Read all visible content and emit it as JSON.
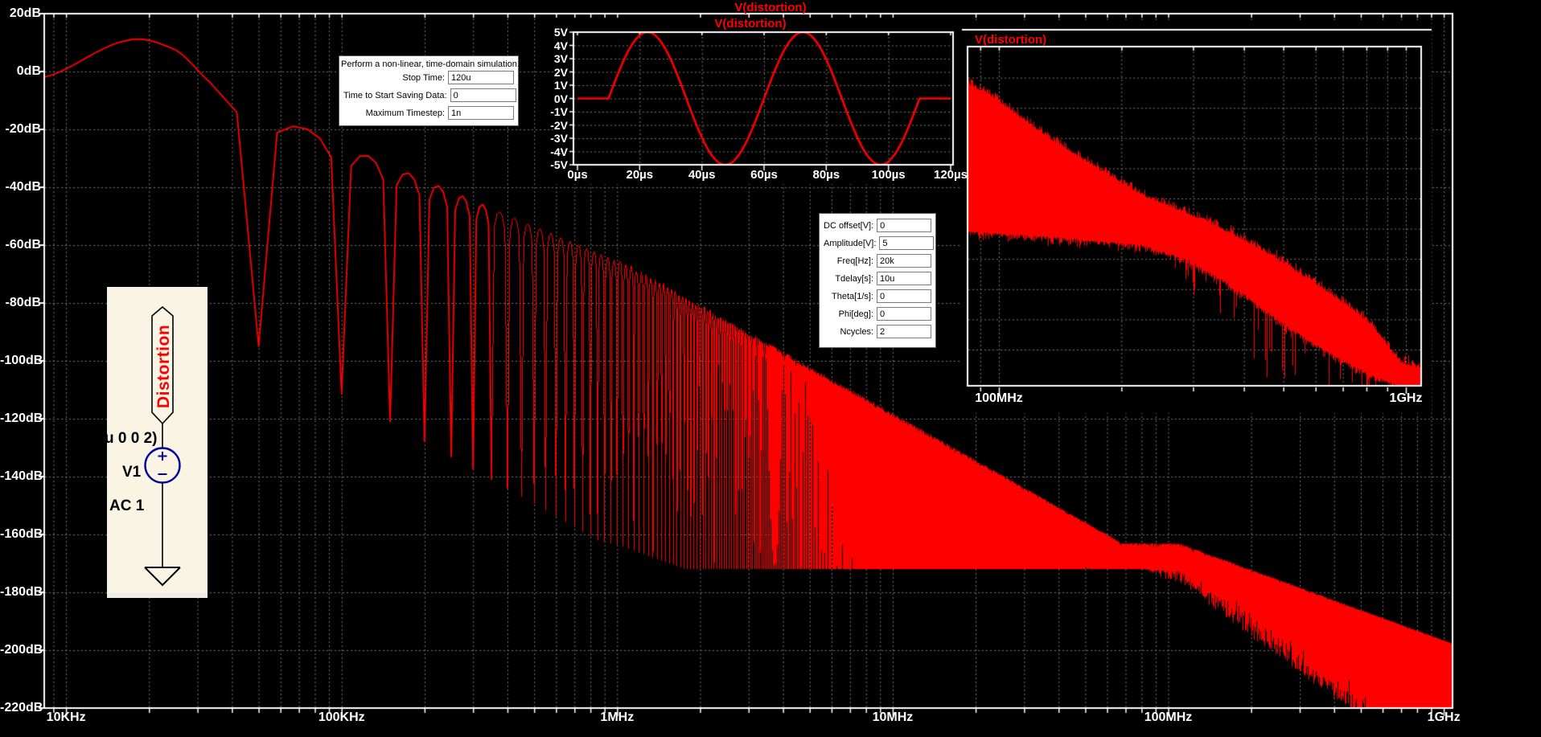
{
  "titles": {
    "main": "V(distortion)",
    "time_inset": "V(distortion)",
    "freq_inset": "V(distortion)"
  },
  "colors": {
    "trace": "#FF0000",
    "grid": "#787878",
    "axis": "#FFFFFF",
    "bg": "#000000",
    "schematic_bg": "#F9F4E4",
    "component": "#0000A0",
    "net_label_text": "#FF0000"
  },
  "transient_dialog": {
    "title": "Perform a non-linear, time-domain simulation.",
    "fields": [
      {
        "label": "Stop Time:",
        "value": "120u"
      },
      {
        "label": "Time to Start Saving Data:",
        "value": "0"
      },
      {
        "label": "Maximum Timestep:",
        "value": "1n"
      }
    ]
  },
  "sine_dialog": {
    "fields": [
      {
        "label": "DC offset[V]:",
        "value": "0"
      },
      {
        "label": "Amplitude[V]:",
        "value": "5"
      },
      {
        "label": "Freq[Hz]:",
        "value": "20k"
      },
      {
        "label": "Tdelay[s]:",
        "value": "10u"
      },
      {
        "label": "Theta[1/s]:",
        "value": "0"
      },
      {
        "label": "Phi[deg]:",
        "value": "0"
      },
      {
        "label": "Ncycles:",
        "value": "2"
      }
    ]
  },
  "schematic": {
    "net_label": "Distortion",
    "overlay_text": "u 0 0 2)",
    "designator": "V1",
    "spice_directive": "AC 1"
  },
  "chart_data": [
    {
      "type": "line",
      "id": "main_fft",
      "title": "V(distortion)",
      "xscale": "log",
      "xrange_hz": [
        8333.3,
        1092000000
      ],
      "yrange_db": [
        -220,
        20
      ],
      "grid": true,
      "legend_position": "top-center",
      "y_ticks": [
        {
          "db": 20,
          "label": "20dB"
        },
        {
          "db": 0,
          "label": "0dB"
        },
        {
          "db": -20,
          "label": "-20dB"
        },
        {
          "db": -40,
          "label": "-40dB"
        },
        {
          "db": -60,
          "label": "-60dB"
        },
        {
          "db": -80,
          "label": "-80dB"
        },
        {
          "db": -100,
          "label": "-100dB"
        },
        {
          "db": -120,
          "label": "-120dB"
        },
        {
          "db": -140,
          "label": "-140dB"
        },
        {
          "db": -160,
          "label": "-160dB"
        },
        {
          "db": -180,
          "label": "-180dB"
        },
        {
          "db": -200,
          "label": "-200dB"
        },
        {
          "db": -220,
          "label": "-220dB"
        }
      ],
      "x_ticks": [
        {
          "f": 10000,
          "label": "10KHz"
        },
        {
          "f": 100000,
          "label": "100KHz"
        },
        {
          "f": 1000000,
          "label": "1MHz"
        },
        {
          "f": 10000000,
          "label": "10MHz"
        },
        {
          "f": 100000000,
          "label": "100MHz"
        },
        {
          "f": 1000000000,
          "label": "1GHz"
        }
      ],
      "model": {
        "amplitude_v": 5,
        "f0_hz": 20000,
        "burst_s": 0.0001,
        "window_s": 0.00012,
        "bin_hz": 8333.333,
        "peak_db": 12,
        "left_edge_db": -6,
        "extra_rolloff_db_per_decade": 14,
        "rolloff_start_hz": 1000000,
        "noise_floor_db": -172,
        "floor_knee_hz": 110000000,
        "floor_slope_db_per_decade": 35,
        "notch_limit": {
          "db_at_ref": -95,
          "ref_hz": 50000,
          "slope_db_per_decade": 54.5,
          "min_db": -172
        }
      }
    },
    {
      "type": "line",
      "id": "time_domain",
      "title": "V(distortion)",
      "xrange_us": [
        0,
        120
      ],
      "yrange_v": [
        -5,
        5
      ],
      "grid": true,
      "params": {
        "amplitude_v": 5,
        "freq_hz": 20000,
        "tdelay_us": 10,
        "ncycles": 2,
        "tstop_us": 120
      },
      "y_ticks": [
        {
          "v": 5,
          "label": "5V"
        },
        {
          "v": 4,
          "label": "4V"
        },
        {
          "v": 3,
          "label": "3V"
        },
        {
          "v": 2,
          "label": "2V"
        },
        {
          "v": 1,
          "label": "1V"
        },
        {
          "v": 0,
          "label": "0V"
        },
        {
          "v": -1,
          "label": "-1V"
        },
        {
          "v": -2,
          "label": "-2V"
        },
        {
          "v": -3,
          "label": "-3V"
        },
        {
          "v": -4,
          "label": "-4V"
        },
        {
          "v": -5,
          "label": "-5V"
        }
      ],
      "x_ticks": [
        {
          "t": 0,
          "label": "0µs"
        },
        {
          "t": 20,
          "label": "20µs"
        },
        {
          "t": 40,
          "label": "40µs"
        },
        {
          "t": 60,
          "label": "60µs"
        },
        {
          "t": 80,
          "label": "80µs"
        },
        {
          "t": 100,
          "label": "100µs"
        },
        {
          "t": 120,
          "label": "120µs"
        }
      ]
    },
    {
      "type": "line",
      "id": "fft_zoom",
      "title": "V(distortion)",
      "xscale": "log",
      "xrange_hz": [
        83700000,
        1092000000
      ],
      "grid": true,
      "x_ticks": [
        {
          "f": 100000000,
          "label": "100MHz"
        },
        {
          "f": 1000000000,
          "label": "1GHz"
        }
      ],
      "top_envelope": [
        {
          "f_hz": 83740000,
          "frac": 0.0974
        },
        {
          "f_hz": 99100000,
          "frac": 0.1497
        },
        {
          "f_hz": 136300000,
          "frac": 0.2708
        },
        {
          "f_hz": 224800000,
          "frac": 0.4299
        },
        {
          "f_hz": 323500000,
          "frac": 0.5059
        },
        {
          "f_hz": 444800000,
          "frac": 0.5914
        },
        {
          "f_hz": 631600000,
          "frac": 0.7078
        },
        {
          "f_hz": 814900000,
          "frac": 0.8076
        },
        {
          "f_hz": 968700000,
          "frac": 0.924
        },
        {
          "f_hz": 1085000000,
          "frac": 0.9406
        }
      ],
      "bottom_envelope": [
        {
          "f_hz": 83740000,
          "frac": 0.5439
        },
        {
          "f_hz": 136300000,
          "frac": 0.5606
        },
        {
          "f_hz": 225700000,
          "frac": 0.5843
        },
        {
          "f_hz": 291000000,
          "frac": 0.6271
        },
        {
          "f_hz": 378000000,
          "frac": 0.7078
        },
        {
          "f_hz": 488000000,
          "frac": 0.8076
        },
        {
          "f_hz": 631600000,
          "frac": 0.8955
        },
        {
          "f_hz": 814900000,
          "frac": 0.9667
        },
        {
          "f_hz": 968700000,
          "frac": 1.0
        },
        {
          "f_hz": 1085000000,
          "frac": 1.0
        }
      ]
    }
  ]
}
